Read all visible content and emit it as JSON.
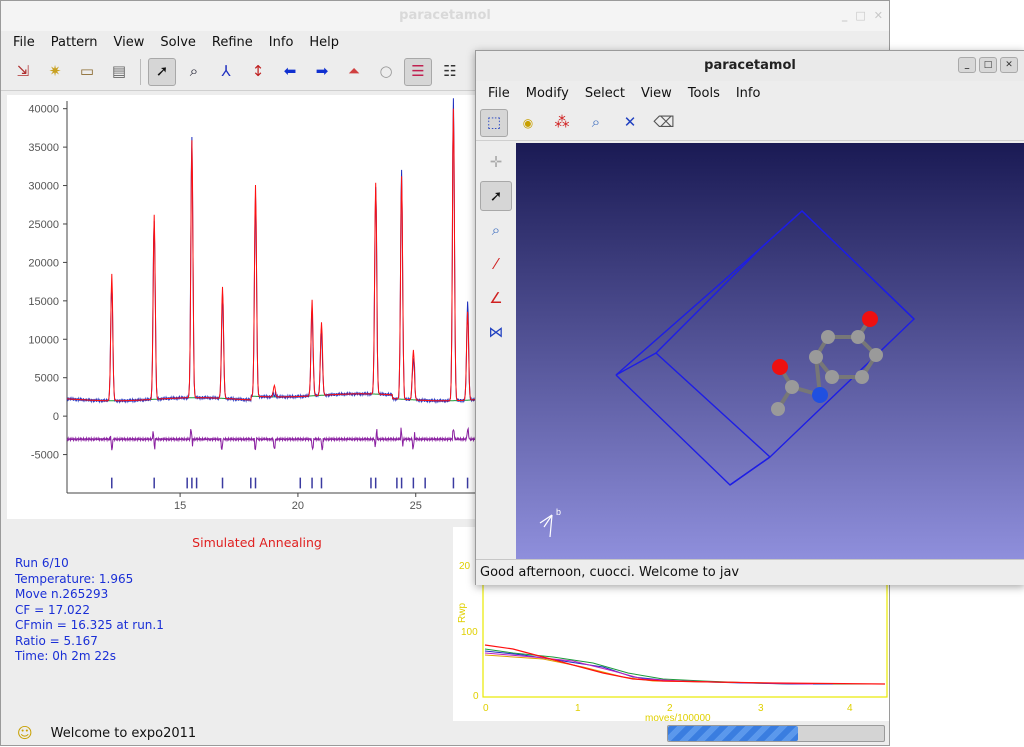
{
  "main": {
    "title": "paracetamol",
    "menu": [
      "File",
      "Pattern",
      "View",
      "Solve",
      "Refine",
      "Info",
      "Help"
    ],
    "status": "Welcome to expo2011",
    "progress": 0.6
  },
  "pattern_plot": {
    "y_ticks": [
      "40000",
      "35000",
      "30000",
      "25000",
      "20000",
      "15000",
      "10000",
      "5000",
      "0",
      "-5000"
    ],
    "x_ticks": [
      "15",
      "20",
      "25"
    ],
    "colors": {
      "observed": "#1f2fbf",
      "calculated": "#ff1010",
      "background": "#1a9a3a",
      "difference": "#8a1fa0",
      "reflections": "#3a3aa0"
    }
  },
  "annealing": {
    "title": "Simulated Annealing",
    "lines": [
      "Run 6/10",
      "Temperature: 1.965",
      "Move n.265293",
      "CF = 17.022",
      "CFmin = 16.325 at run.1",
      "Ratio = 5.167",
      "Time: 0h 2m 22s"
    ]
  },
  "rwp_plot": {
    "ylabel": "Rwp",
    "xlabel": "moves/100000",
    "y_ticks": [
      "20",
      "100",
      "0"
    ],
    "x_ticks": [
      "0",
      "1",
      "2",
      "3",
      "4"
    ]
  },
  "viewer": {
    "title": "paracetamol",
    "menu": [
      "File",
      "Modify",
      "Select",
      "View",
      "Tools",
      "Info"
    ],
    "status": "Good afternoon, cuocci.  Welcome to jav",
    "axis_label": "b"
  }
}
